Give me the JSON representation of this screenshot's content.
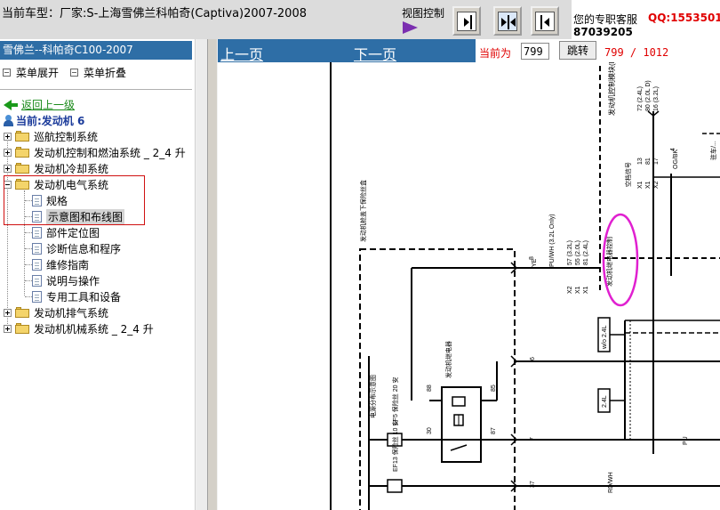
{
  "header": {
    "car_title": "当前车型：厂家:S-上海雪佛兰科帕奇(Captiva)2007-2008",
    "view_label": "视图控制",
    "service_label": "您的专职客服",
    "qq": "QQ:15535013",
    "phone": "87039205"
  },
  "sidebar": {
    "title": "雪佛兰--科帕奇C100-2007",
    "expand_all": "菜单展开",
    "collapse_all": "菜单折叠",
    "back": "返回上一级",
    "current": "当前:发动机 6",
    "items": [
      {
        "label": "巡航控制系统",
        "type": "folder",
        "expander": "plus"
      },
      {
        "label": "发动机控制和燃油系统 _ 2_4 升",
        "type": "folder",
        "expander": "plus"
      },
      {
        "label": "发动机冷却系统",
        "type": "folder",
        "expander": "plus"
      },
      {
        "label": "发动机电气系统",
        "type": "folder",
        "expander": "minus"
      },
      {
        "label": "规格",
        "type": "doc"
      },
      {
        "label": "示意图和布线图",
        "type": "doc",
        "selected": true
      },
      {
        "label": "部件定位图",
        "type": "doc"
      },
      {
        "label": "诊断信息和程序",
        "type": "doc"
      },
      {
        "label": "维修指南",
        "type": "doc"
      },
      {
        "label": "说明与操作",
        "type": "doc"
      },
      {
        "label": "专用工具和设备",
        "type": "doc"
      },
      {
        "label": "发动机排气系统",
        "type": "folder",
        "expander": "plus"
      },
      {
        "label": "发动机机械系统 _ 2_4 升",
        "type": "folder",
        "expander": "plus"
      }
    ]
  },
  "nav": {
    "prev": "上一页",
    "next": "下一页",
    "current_label": "当前为",
    "page_value": "799",
    "jump": "跳转",
    "counter": "799 / 1012"
  },
  "diagram": {
    "ecm_label": "发动机控制模块(ECM)",
    "pins_top": [
      "72 (2.4L)",
      "80 (2.0L D)",
      "16 (3.2L)"
    ],
    "wire_colors_top": [
      "13",
      "81",
      "17",
      "OG/BK"
    ],
    "x_labels_top": [
      "X1",
      "X1",
      "X2"
    ],
    "pin_4": "4",
    "air_conditioning_signal": "空档信号",
    "relay_control": "发动机继电器控制",
    "pins_relay": [
      "57 (3.2L)",
      "55 (2.0L)",
      "81 (2.4L)"
    ],
    "x_labels_relay": [
      "X2",
      "X1",
      "X1"
    ],
    "wire_pu_wh": "PU/WH (3.2L Only)",
    "wire_ye": "YE",
    "fuse_block_title": "发动机舱盖下保险丝盒",
    "pin_8": "8",
    "pin_6": "6",
    "pin_7": "7",
    "pin_37": "37",
    "pin_88": "88",
    "pin_85": "85",
    "pin_30": "30",
    "pin_87": "87",
    "relay_label": "发动机继电器",
    "fuse_ef5": "EF5 保险丝 20 安",
    "fuse_ef13": "EF13 保险丝 10 安",
    "power_dist": "电源分布示意图",
    "w_o_24": "w/o 2.4L",
    "l_24": "2.4L",
    "wire_pu": "PU",
    "wire_rd_wh": "RD/WH",
    "right_label": "驻车/..."
  }
}
